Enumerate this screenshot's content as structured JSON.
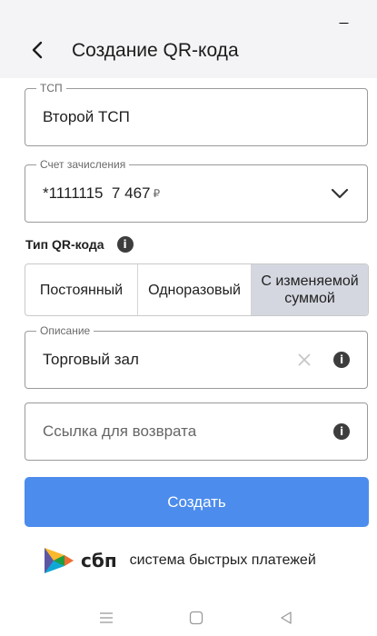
{
  "header": {
    "title": "Создание QR-кода"
  },
  "fields": {
    "tsp": {
      "legend": "ТСП",
      "value": "Второй ТСП"
    },
    "account": {
      "legend": "Счет зачисления",
      "value": "*1111115  7 467",
      "currency": "₽"
    },
    "description": {
      "legend": "Описание",
      "value": "Торговый зал"
    },
    "return_link": {
      "placeholder": "Ссылка для возврата"
    }
  },
  "qr_type": {
    "label": "Тип QR-кода",
    "options": [
      {
        "label": "Постоянный"
      },
      {
        "label": "Одноразовый"
      },
      {
        "label": "С изменяемой суммой"
      }
    ],
    "selected_index": 2
  },
  "actions": {
    "create_label": "Создать"
  },
  "sbp": {
    "name": "сбп",
    "description": "система быстрых платежей"
  },
  "colors": {
    "primary": "#4c8cec",
    "segment_active": "#d4d7e0",
    "header_bg": "#f4f4f6"
  }
}
